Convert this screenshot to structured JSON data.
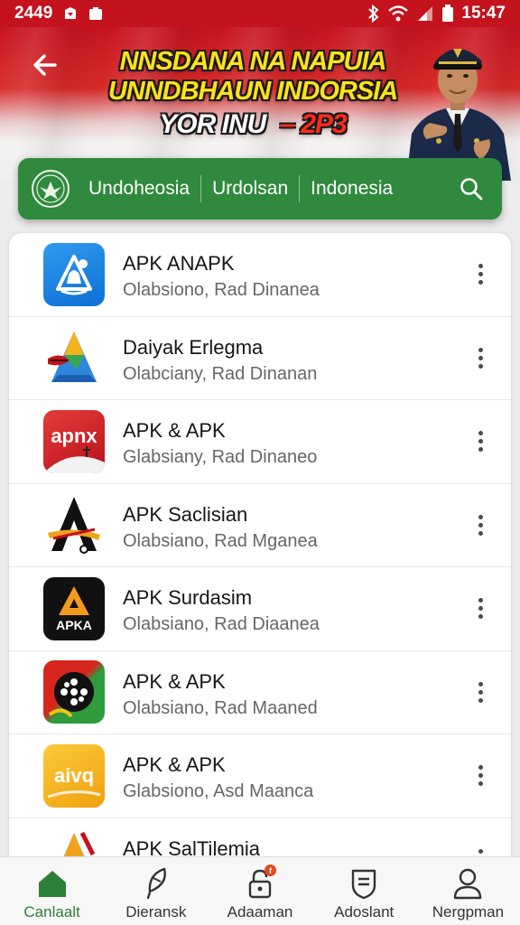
{
  "status_bar": {
    "time_left": "2449",
    "time_right": "15:47"
  },
  "banner": {
    "line1": "NNSDANA NA NAPUIA",
    "line2": "UNNDBHAUN INDORSIA",
    "line3_left": "YOR INU",
    "line3_right": "– 2P3"
  },
  "tabs": {
    "items": [
      "Undoheosia",
      "Urdolsan",
      "Indonesia"
    ]
  },
  "apps": [
    {
      "title": "APK ANAPK",
      "subtitle": "Olabsiono, Rad Dinanea",
      "icon": "blue-bell-icon"
    },
    {
      "title": "Daiyak Erlegma",
      "subtitle": "Olabciany, Rad Dinanan",
      "icon": "triangle-logo-icon"
    },
    {
      "title": "APK & APK",
      "subtitle": "Glabsiany, Rad Dinaneo",
      "icon": "red-apk-icon"
    },
    {
      "title": "APK Saclisian",
      "subtitle": "Olabsiano, Rad Mganea",
      "icon": "black-a-logo-icon"
    },
    {
      "title": "APK Surdasim",
      "subtitle": "Olabsiano, Rad Diaanea",
      "icon": "apka-logo-icon",
      "icon_text": "APKA"
    },
    {
      "title": "APK & APK",
      "subtitle": "Olabsiano, Rad Maaned",
      "icon": "film-reel-icon"
    },
    {
      "title": "APK & APK",
      "subtitle": "Glabsiono, Asd Maanca",
      "icon": "yellow-apk-icon",
      "icon_text": "aivq"
    },
    {
      "title": "APK SalTilemia",
      "subtitle": "",
      "icon": "partial-triangle-icon"
    }
  ],
  "red_icon_text": "apnx",
  "nav": [
    {
      "label": "Canlaalt",
      "icon": "home-icon",
      "active": true
    },
    {
      "label": "Dieransk",
      "icon": "feather-icon",
      "active": false
    },
    {
      "label": "Adaaman",
      "icon": "lock-icon",
      "active": false,
      "badge": "f"
    },
    {
      "label": "Adoslant",
      "icon": "shield-icon",
      "active": false
    },
    {
      "label": "Nergpman",
      "icon": "person-icon",
      "active": false
    }
  ],
  "colors": {
    "status_red": "#c4131d",
    "bar_green": "#2f8a3d",
    "active_green": "#2c7f37",
    "banner_yellow": "#ffe21a"
  }
}
